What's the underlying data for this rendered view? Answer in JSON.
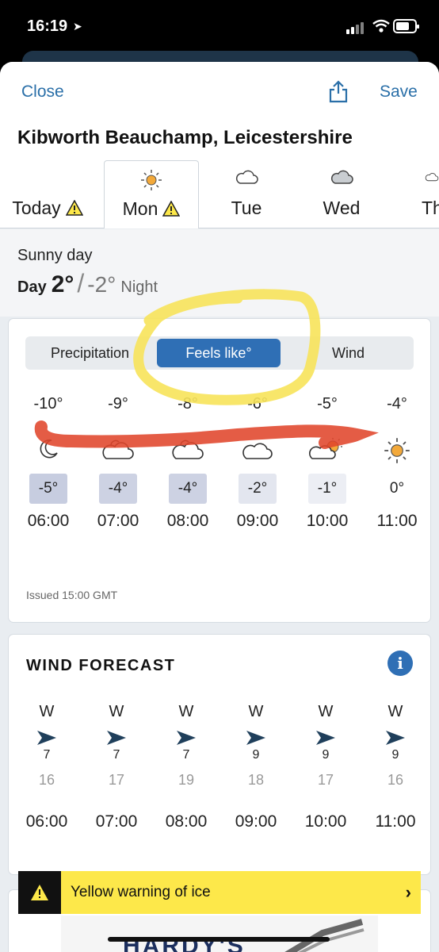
{
  "status": {
    "time": "16:19"
  },
  "header": {
    "close": "Close",
    "save": "Save",
    "location": "Kibworth Beauchamp, Leicestershire"
  },
  "tabs": [
    {
      "label": "Today",
      "warning": true,
      "icon": "none"
    },
    {
      "label": "Mon",
      "warning": true,
      "icon": "sun-icon"
    },
    {
      "label": "Tue",
      "warning": false,
      "icon": "cloud-icon"
    },
    {
      "label": "Wed",
      "warning": false,
      "icon": "grey-cloud-icon"
    },
    {
      "label": "Th",
      "warning": false,
      "icon": "cloud-icon"
    }
  ],
  "summary": {
    "description": "Sunny day",
    "day_label": "Day",
    "day_temp": "2°",
    "night_temp": "-2°",
    "night_label": "Night"
  },
  "toggle": {
    "precipitation": "Precipitation",
    "feels_like": "Feels like°",
    "wind": "Wind"
  },
  "hourly": [
    {
      "feels": "-10°",
      "icon": "moon-icon",
      "temp": "-5°",
      "hour": "06:00",
      "shade": "#c7cde0"
    },
    {
      "feels": "-9°",
      "icon": "partly-cloudy-icon",
      "temp": "-4°",
      "hour": "07:00",
      "shade": "#cdd2e3"
    },
    {
      "feels": "-8°",
      "icon": "partly-cloudy-icon",
      "temp": "-4°",
      "hour": "08:00",
      "shade": "#cdd2e3"
    },
    {
      "feels": "-6°",
      "icon": "cloud-icon",
      "temp": "-2°",
      "hour": "09:00",
      "shade": "#e3e6ef"
    },
    {
      "feels": "-5°",
      "icon": "sun-cloud-icon",
      "temp": "-1°",
      "hour": "10:00",
      "shade": "#eceef4"
    },
    {
      "feels": "-4°",
      "icon": "sun-icon",
      "temp": "0°",
      "hour": "11:00",
      "shade": "#ffffff"
    }
  ],
  "issued": "Issued 15:00 GMT",
  "wind": {
    "title": "WIND FORECAST",
    "info": "i",
    "hours": [
      {
        "dir": "W",
        "speed": "7",
        "gust": "16",
        "hour": "06:00"
      },
      {
        "dir": "W",
        "speed": "7",
        "gust": "17",
        "hour": "07:00"
      },
      {
        "dir": "W",
        "speed": "7",
        "gust": "19",
        "hour": "08:00"
      },
      {
        "dir": "W",
        "speed": "9",
        "gust": "18",
        "hour": "09:00"
      },
      {
        "dir": "W",
        "speed": "9",
        "gust": "17",
        "hour": "10:00"
      },
      {
        "dir": "W",
        "speed": "9",
        "gust": "16",
        "hour": "11:00"
      }
    ]
  },
  "warning": {
    "text": "Yellow warning of ice",
    "icon": "!"
  },
  "ad": {
    "text": "HARDY'S"
  },
  "colors": {
    "accent": "#2f6fb5",
    "link": "#2a6fa8",
    "warning": "#fde84a",
    "annotation_yellow": "#f7e35a",
    "annotation_red": "#e0462b"
  }
}
